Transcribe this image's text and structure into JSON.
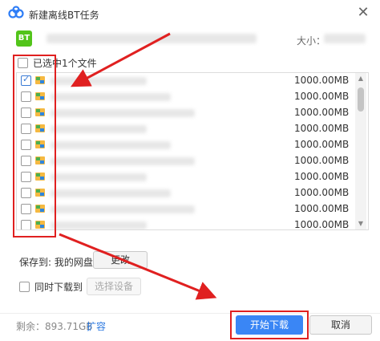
{
  "window": {
    "title": "新建离线BT任务"
  },
  "torrent": {
    "badge": "BT",
    "size_label": "大小："
  },
  "list": {
    "select_all_label": "已选中1个文件",
    "rows": [
      {
        "checked": true,
        "size": "1000.00MB"
      },
      {
        "checked": false,
        "size": "1000.00MB"
      },
      {
        "checked": false,
        "size": "1000.00MB"
      },
      {
        "checked": false,
        "size": "1000.00MB"
      },
      {
        "checked": false,
        "size": "1000.00MB"
      },
      {
        "checked": false,
        "size": "1000.00MB"
      },
      {
        "checked": false,
        "size": "1000.00MB"
      },
      {
        "checked": false,
        "size": "1000.00MB"
      },
      {
        "checked": false,
        "size": "1000.00MB"
      },
      {
        "checked": false,
        "size": "1000.00MB"
      }
    ]
  },
  "save": {
    "label": "保存到: 我的网盘",
    "change_button": "更改"
  },
  "sync": {
    "label": "同时下载到",
    "choose_device_button": "选择设备"
  },
  "footer": {
    "remaining": "剩余：893.71GB",
    "expand_link": "扩容",
    "start_button": "开始下载",
    "cancel_button": "取消"
  },
  "colors": {
    "accent": "#3a86f5",
    "annotation": "#e02020",
    "badge": "#52c41a"
  }
}
